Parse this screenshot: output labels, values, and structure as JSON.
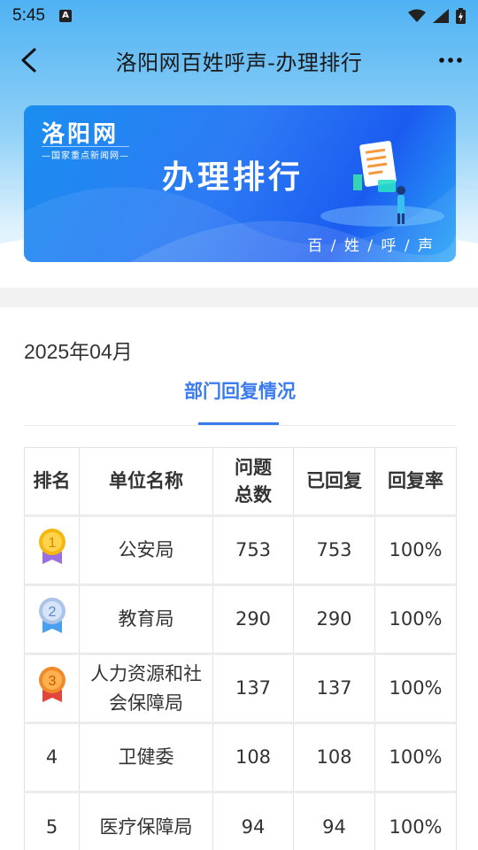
{
  "status": {
    "time": "5:45",
    "notif_letter": "A"
  },
  "header": {
    "title": "洛阳网百姓呼声-办理排行"
  },
  "banner": {
    "logo": "洛阳网",
    "logo_sub": "—国家重点新闻网—",
    "title": "办理排行",
    "slogan": "百 / 姓 / 呼 / 声"
  },
  "month": "2025年04月",
  "tab": {
    "label": "部门回复情况"
  },
  "table": {
    "headers": [
      "排名",
      "单位名称",
      "问题总数",
      "已回复",
      "回复率"
    ],
    "rows": [
      {
        "rank": "1",
        "medal": "gold-medal-icon",
        "unit": "公安局",
        "total": "753",
        "replied": "753",
        "rate": "100%"
      },
      {
        "rank": "2",
        "medal": "silver-medal-icon",
        "unit": "教育局",
        "total": "290",
        "replied": "290",
        "rate": "100%"
      },
      {
        "rank": "3",
        "medal": "bronze-medal-icon",
        "unit": "人力资源和社会保障局",
        "total": "137",
        "replied": "137",
        "rate": "100%"
      },
      {
        "rank": "4",
        "unit": "卫健委",
        "total": "108",
        "replied": "108",
        "rate": "100%"
      },
      {
        "rank": "5",
        "unit": "医疗保障局",
        "total": "94",
        "replied": "94",
        "rate": "100%"
      }
    ]
  },
  "colors": {
    "accent": "#3a7bf0",
    "gold": "#f5b80e",
    "silver": "#a9c4e8",
    "bronze": "#f08a2a"
  }
}
